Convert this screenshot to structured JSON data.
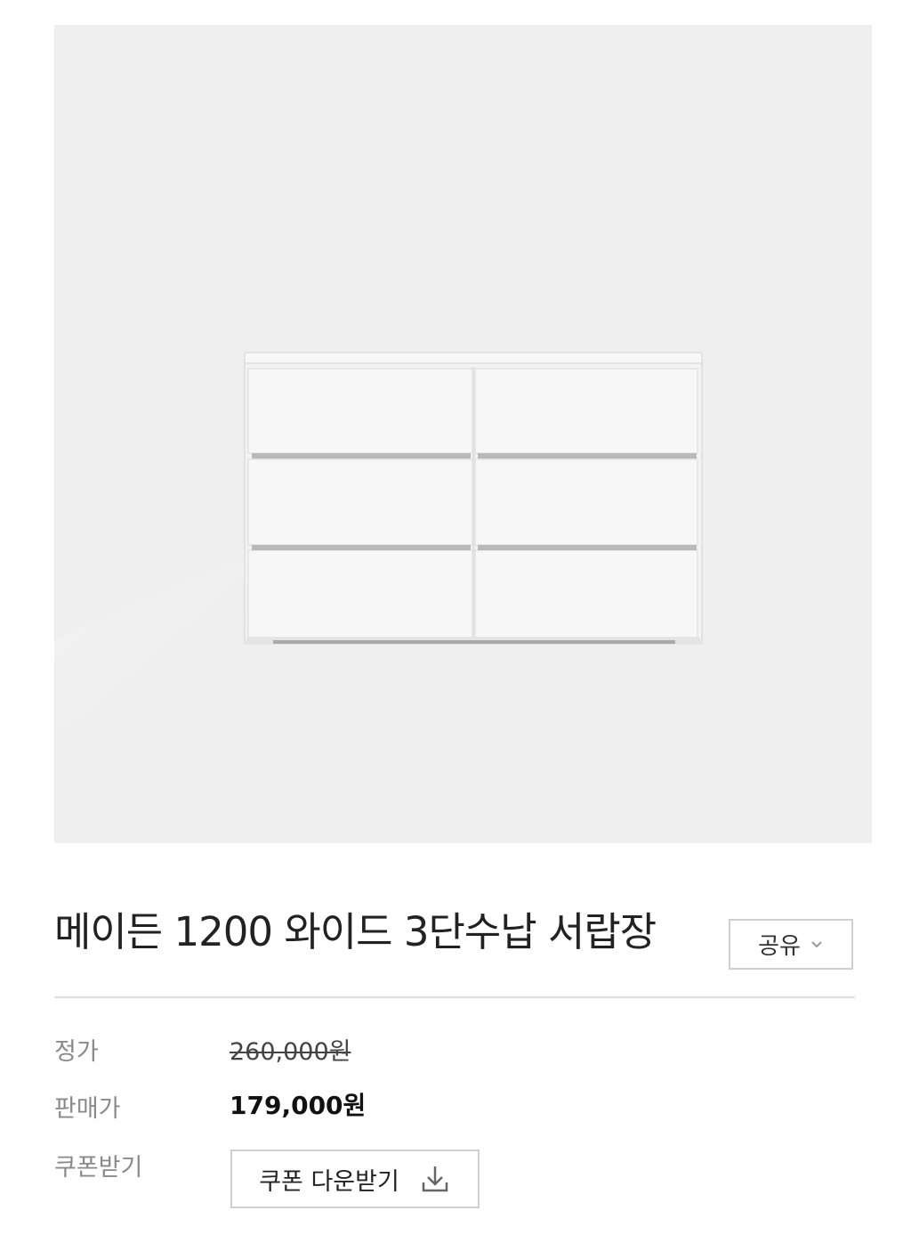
{
  "product": {
    "title": "메이든 1200 와이드 3단수납 서랍장",
    "image_alt": "white 6-drawer wide dresser",
    "share_label": "공유"
  },
  "pricing": {
    "list_price_label": "정가",
    "list_price": "260,000원",
    "sale_price_label": "판매가",
    "sale_price": "179,000원",
    "coupon_label": "쿠폰받기",
    "coupon_button_label": "쿠폰 다운받기"
  },
  "icons": {
    "share_chevron": "chevron-down-icon",
    "coupon_download": "download-icon"
  },
  "colors": {
    "image_background": "#efefef",
    "divider": "#dddddd",
    "label_gray": "#8a8a8a",
    "border_gray": "#cfcfcf"
  }
}
